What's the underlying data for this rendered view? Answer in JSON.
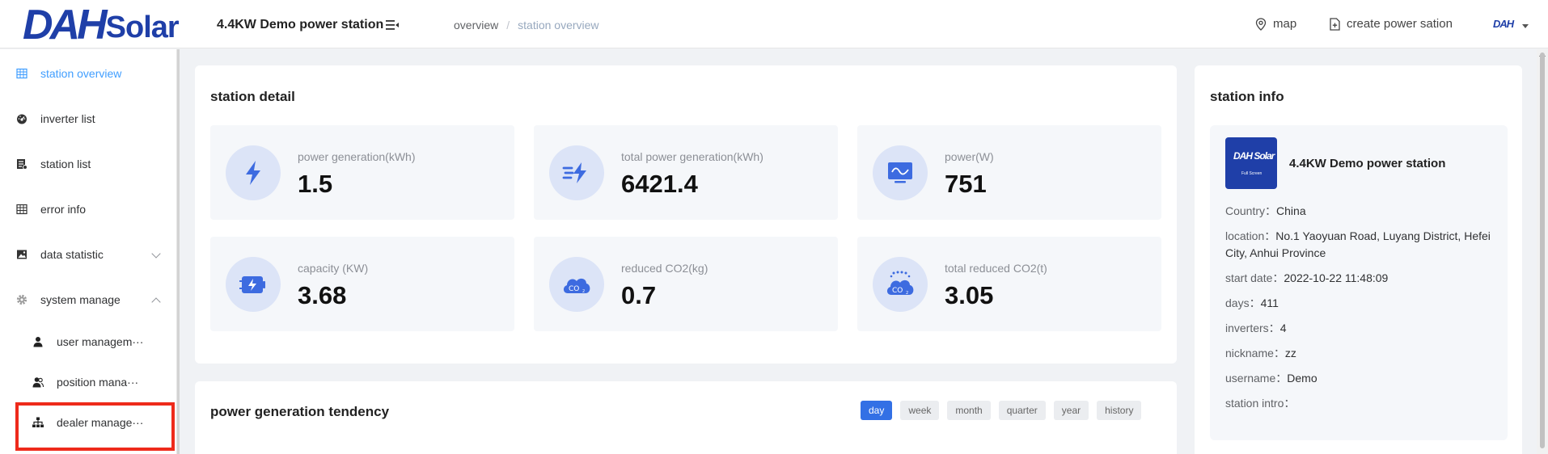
{
  "header": {
    "logo_main": "DAH",
    "logo_sub": "Solar",
    "station_title": "4.4KW Demo power station",
    "breadcrumb": {
      "home": "overview",
      "sep": "/",
      "current": "station overview"
    },
    "map_label": "map",
    "create_label": "create power sation",
    "avatar_text": "DAH"
  },
  "sidebar": {
    "items": [
      {
        "label": "station overview",
        "icon": "grid-icon"
      },
      {
        "label": "inverter list",
        "icon": "dashboard-icon"
      },
      {
        "label": "station list",
        "icon": "station-list-icon"
      },
      {
        "label": "error info",
        "icon": "table-icon"
      },
      {
        "label": "data statistic",
        "icon": "picture-icon"
      },
      {
        "label": "system manage",
        "icon": "gear-icon"
      },
      {
        "label": "user managem···",
        "icon": "user-icon"
      },
      {
        "label": "position mana···",
        "icon": "position-users-icon"
      },
      {
        "label": "dealer manage···",
        "icon": "hierarchy-icon"
      }
    ]
  },
  "station_detail": {
    "title": "station detail",
    "cards": [
      {
        "label": "power generation(kWh)",
        "value": "1.5",
        "icon": "lightning-icon"
      },
      {
        "label": "total power generation(kWh)",
        "value": "6421.4",
        "icon": "fast-lightning-icon"
      },
      {
        "label": "power(W)",
        "value": "751",
        "icon": "monitor-icon"
      },
      {
        "label": "capacity (KW)",
        "value": "3.68",
        "icon": "battery-icon"
      },
      {
        "label": "reduced CO2(kg)",
        "value": "0.7",
        "icon": "co2-cloud-icon"
      },
      {
        "label": "total reduced CO2(t)",
        "value": "3.05",
        "icon": "co2-total-icon"
      }
    ]
  },
  "tendency": {
    "title": "power generation tendency",
    "tabs": [
      "day",
      "week",
      "month",
      "quarter",
      "year",
      "history"
    ],
    "active_tab": "day"
  },
  "station_info": {
    "title": "station info",
    "logo_text": "DAH Solar",
    "logo_sub": "Full Screen",
    "name": "4.4KW Demo power station",
    "rows": [
      {
        "key": "Country：",
        "value": "China"
      },
      {
        "key": "location：",
        "value": "No.1 Yaoyuan Road, Luyang District, Hefei City, Anhui Province"
      },
      {
        "key": "start date：",
        "value": "2022-10-22 11:48:09"
      },
      {
        "key": "days：",
        "value": "411"
      },
      {
        "key": "inverters：",
        "value": "4"
      },
      {
        "key": "nickname：",
        "value": "zz"
      },
      {
        "key": "username：",
        "value": "Demo"
      },
      {
        "key": "station intro：",
        "value": ""
      }
    ]
  },
  "colors": {
    "brand": "#1f3fa8",
    "active_menu": "#409eff",
    "active_tab": "#3370e5",
    "highlight": "#ee2a1b",
    "icon_circle": "#dce4f7",
    "icon_fg": "#3d6be0"
  }
}
